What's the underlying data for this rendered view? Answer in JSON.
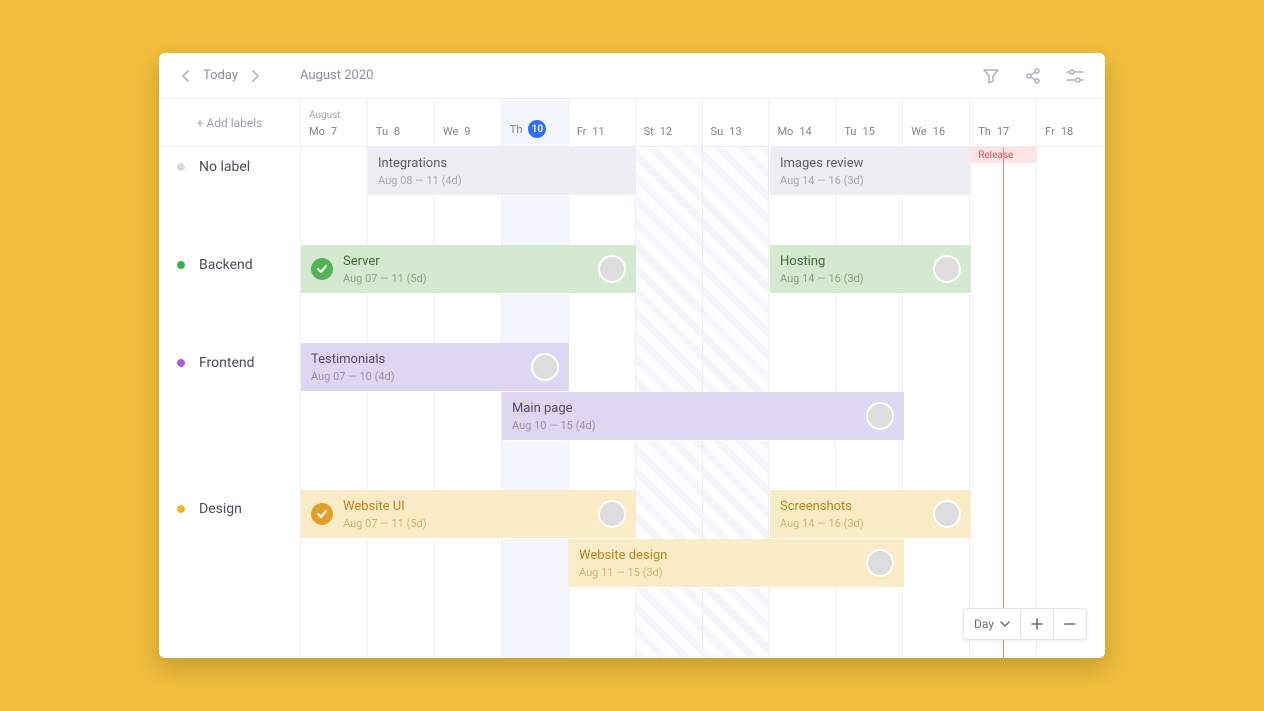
{
  "toolbar": {
    "today_label": "Today",
    "month_label": "August 2020"
  },
  "sidebar": {
    "add_labels": "+ Add labels",
    "labels": [
      {
        "name": "No label",
        "color": "#d9dbe0"
      },
      {
        "name": "Backend",
        "color": "#2fb24c"
      },
      {
        "name": "Frontend",
        "color": "#a95ede"
      },
      {
        "name": "Design",
        "color": "#e9b922"
      }
    ]
  },
  "columns": {
    "month_name": "August",
    "days": [
      {
        "dow": "Mo",
        "num": "7"
      },
      {
        "dow": "Tu",
        "num": "8"
      },
      {
        "dow": "We",
        "num": "9"
      },
      {
        "dow": "Th",
        "num": "10",
        "is_today": true
      },
      {
        "dow": "Fr",
        "num": "11"
      },
      {
        "dow": "St",
        "num": "12",
        "weekend": true
      },
      {
        "dow": "Su",
        "num": "13",
        "weekend": true
      },
      {
        "dow": "Mo",
        "num": "14"
      },
      {
        "dow": "Tu",
        "num": "15"
      },
      {
        "dow": "We",
        "num": "16"
      },
      {
        "dow": "Th",
        "num": "17",
        "milestone": "Release"
      },
      {
        "dow": "Fr",
        "num": "18"
      }
    ]
  },
  "milestone_label": "Release",
  "tasks": {
    "integrations": {
      "title": "Integrations",
      "sub": "Aug 08 — 11 (4d)"
    },
    "images_review": {
      "title": "Images review",
      "sub": "Aug 14 — 16 (3d)"
    },
    "server": {
      "title": "Server",
      "sub": "Aug 07 — 11 (5d)"
    },
    "hosting": {
      "title": "Hosting",
      "sub": "Aug 14 — 16 (3d)"
    },
    "testimonials": {
      "title": "Testimonials",
      "sub": "Aug 07 — 10 (4d)"
    },
    "main_page": {
      "title": "Main page",
      "sub": "Aug 10 — 15 (4d)"
    },
    "website_ui": {
      "title": "Website UI",
      "sub": "Aug 07 — 11 (5d)"
    },
    "screenshots": {
      "title": "Screenshots",
      "sub": "Aug 14 — 16 (3d)"
    },
    "website_design": {
      "title": "Website design",
      "sub": "Aug 11 — 15 (3d)"
    }
  },
  "zoom": {
    "mode": "Day"
  }
}
